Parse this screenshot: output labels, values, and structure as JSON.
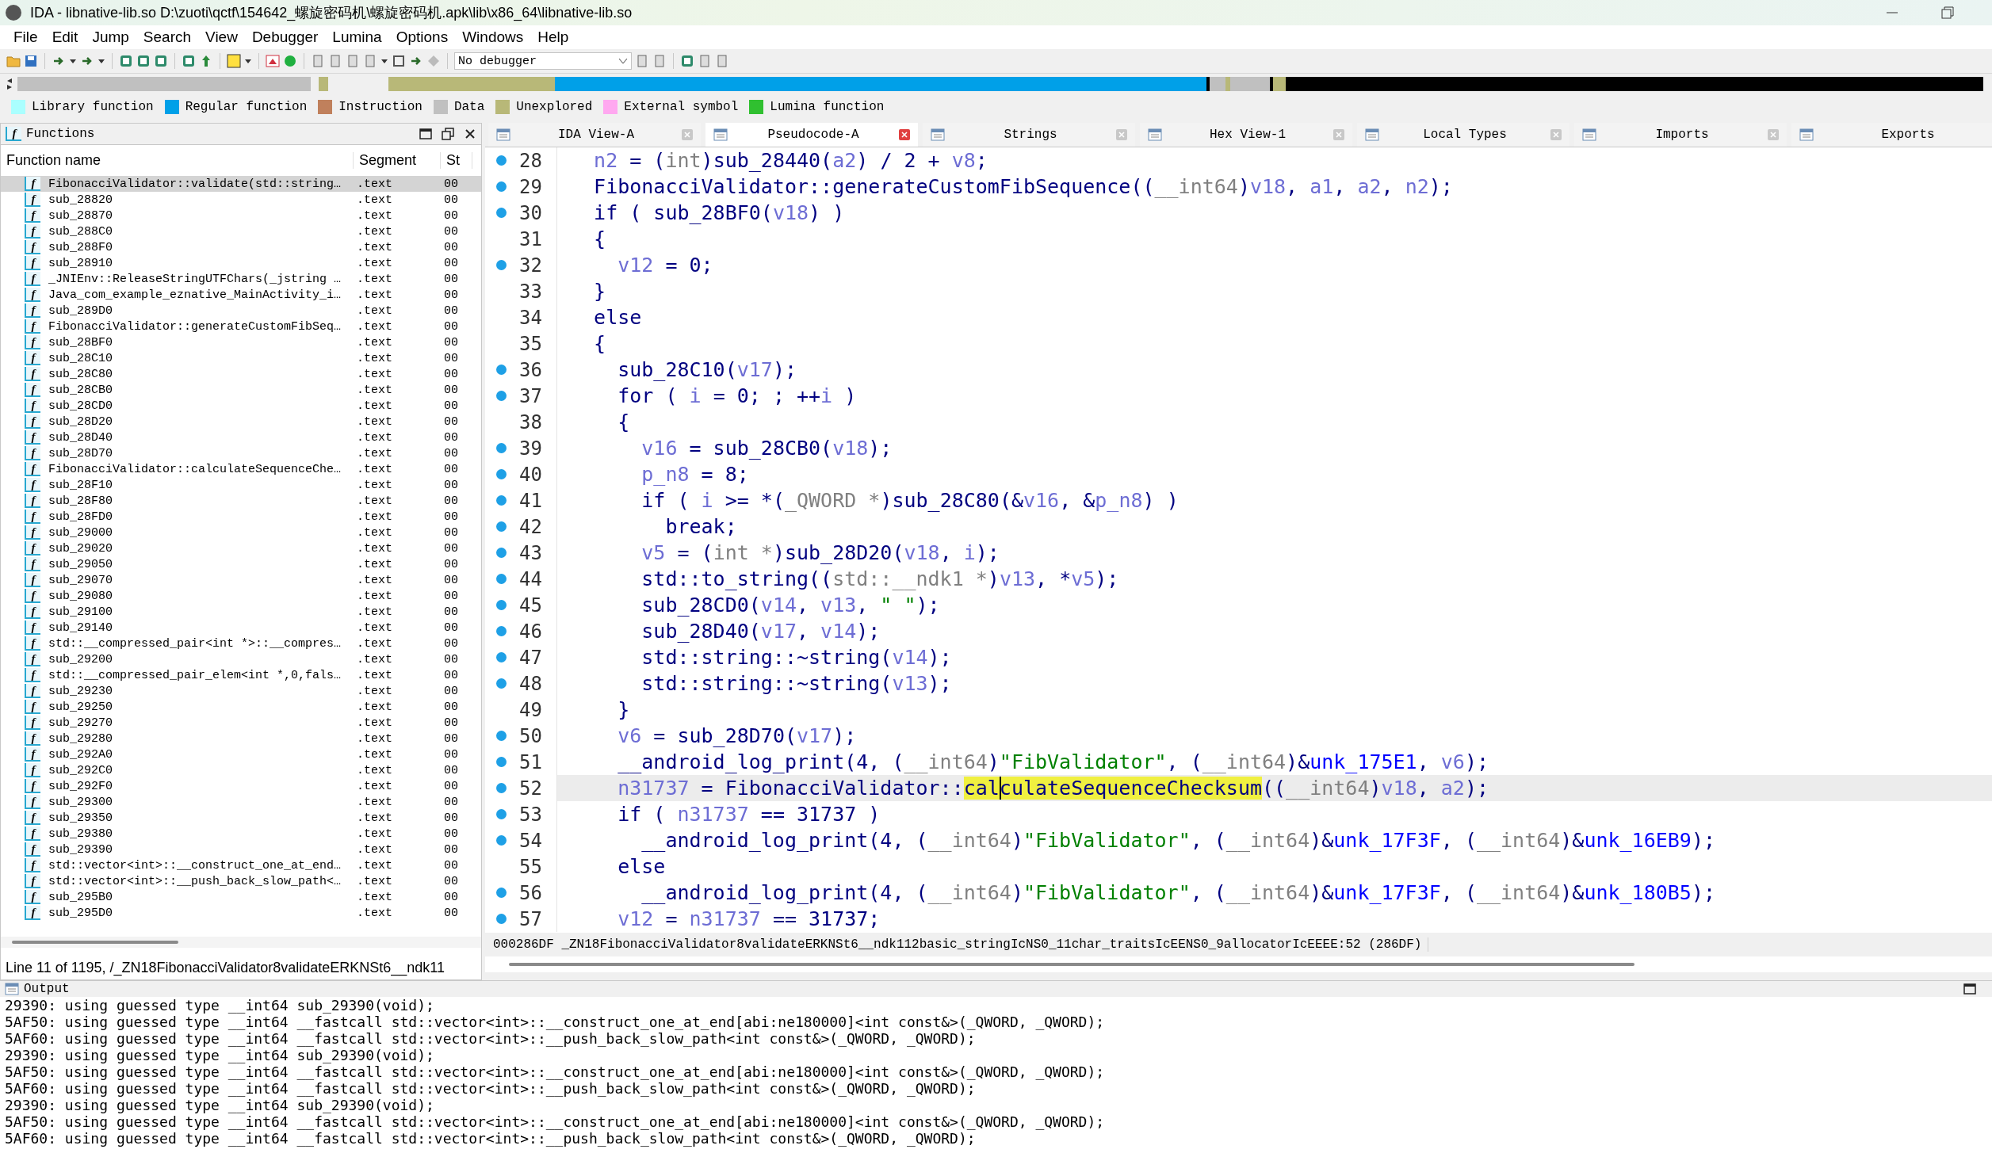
{
  "window": {
    "title": "IDA - libnative-lib.so D:\\zuoti\\qctf\\154642_螺旋密码机\\螺旋密码机.apk\\lib\\x86_64\\libnative-lib.so"
  },
  "menu": [
    "File",
    "Edit",
    "Jump",
    "Search",
    "View",
    "Debugger",
    "Lumina",
    "Options",
    "Windows",
    "Help"
  ],
  "toolbar": {
    "debugger_select": "No debugger"
  },
  "legend": [
    {
      "label": "Library function",
      "color": "#aaffff"
    },
    {
      "label": "Regular function",
      "color": "#00a0e8"
    },
    {
      "label": "Instruction",
      "color": "#c0805c"
    },
    {
      "label": "Data",
      "color": "#c0c0c0"
    },
    {
      "label": "Unexplored",
      "color": "#b8b878"
    },
    {
      "label": "External symbol",
      "color": "#ffa8f0"
    },
    {
      "label": "Lumina function",
      "color": "#30c030"
    }
  ],
  "functions": {
    "title": "Functions",
    "icon": "f",
    "columns": [
      "Function name",
      "Segment",
      "St"
    ],
    "rows": [
      {
        "icon": "f",
        "name": "FibonacciValidator::validate(std::string…",
        "segment": ".text",
        "st": "00",
        "selected": true
      },
      {
        "icon": "f",
        "name": "sub_28820",
        "segment": ".text",
        "st": "00",
        "selected": false
      },
      {
        "icon": "f",
        "name": "sub_28870",
        "segment": ".text",
        "st": "00",
        "selected": false
      },
      {
        "icon": "f",
        "name": "sub_288C0",
        "segment": ".text",
        "st": "00",
        "selected": false
      },
      {
        "icon": "f",
        "name": "sub_288F0",
        "segment": ".text",
        "st": "00",
        "selected": false
      },
      {
        "icon": "f",
        "name": "sub_28910",
        "segment": ".text",
        "st": "00",
        "selected": false
      },
      {
        "icon": "f",
        "name": "_JNIEnv::ReleaseStringUTFChars(_jstring …",
        "segment": ".text",
        "st": "00",
        "selected": false
      },
      {
        "icon": "f",
        "name": "Java_com_example_eznative_MainActivity_i…",
        "segment": ".text",
        "st": "00",
        "selected": false
      },
      {
        "icon": "f",
        "name": "sub_289D0",
        "segment": ".text",
        "st": "00",
        "selected": false
      },
      {
        "icon": "f",
        "name": "FibonacciValidator::generateCustomFibSeq…",
        "segment": ".text",
        "st": "00",
        "selected": false
      },
      {
        "icon": "f",
        "name": "sub_28BF0",
        "segment": ".text",
        "st": "00",
        "selected": false
      },
      {
        "icon": "f",
        "name": "sub_28C10",
        "segment": ".text",
        "st": "00",
        "selected": false
      },
      {
        "icon": "f",
        "name": "sub_28C80",
        "segment": ".text",
        "st": "00",
        "selected": false
      },
      {
        "icon": "f",
        "name": "sub_28CB0",
        "segment": ".text",
        "st": "00",
        "selected": false
      },
      {
        "icon": "f",
        "name": "sub_28CD0",
        "segment": ".text",
        "st": "00",
        "selected": false
      },
      {
        "icon": "f",
        "name": "sub_28D20",
        "segment": ".text",
        "st": "00",
        "selected": false
      },
      {
        "icon": "f",
        "name": "sub_28D40",
        "segment": ".text",
        "st": "00",
        "selected": false
      },
      {
        "icon": "f",
        "name": "sub_28D70",
        "segment": ".text",
        "st": "00",
        "selected": false
      },
      {
        "icon": "f",
        "name": "FibonacciValidator::calculateSequenceChe…",
        "segment": ".text",
        "st": "00",
        "selected": false
      },
      {
        "icon": "f",
        "name": "sub_28F10",
        "segment": ".text",
        "st": "00",
        "selected": false
      },
      {
        "icon": "f",
        "name": "sub_28F80",
        "segment": ".text",
        "st": "00",
        "selected": false
      },
      {
        "icon": "f",
        "name": "sub_28FD0",
        "segment": ".text",
        "st": "00",
        "selected": false
      },
      {
        "icon": "f",
        "name": "sub_29000",
        "segment": ".text",
        "st": "00",
        "selected": false
      },
      {
        "icon": "f",
        "name": "sub_29020",
        "segment": ".text",
        "st": "00",
        "selected": false
      },
      {
        "icon": "f",
        "name": "sub_29050",
        "segment": ".text",
        "st": "00",
        "selected": false
      },
      {
        "icon": "f",
        "name": "sub_29070",
        "segment": ".text",
        "st": "00",
        "selected": false
      },
      {
        "icon": "f",
        "name": "sub_29080",
        "segment": ".text",
        "st": "00",
        "selected": false
      },
      {
        "icon": "f",
        "name": "sub_29100",
        "segment": ".text",
        "st": "00",
        "selected": false
      },
      {
        "icon": "f",
        "name": "sub_29140",
        "segment": ".text",
        "st": "00",
        "selected": false
      },
      {
        "icon": "f",
        "name": "std::__compressed_pair<int *>::__compres…",
        "segment": ".text",
        "st": "00",
        "selected": false
      },
      {
        "icon": "f",
        "name": "sub_29200",
        "segment": ".text",
        "st": "00",
        "selected": false
      },
      {
        "icon": "f",
        "name": "std::__compressed_pair_elem<int *,0,fals…",
        "segment": ".text",
        "st": "00",
        "selected": false
      },
      {
        "icon": "f",
        "name": "sub_29230",
        "segment": ".text",
        "st": "00",
        "selected": false
      },
      {
        "icon": "f",
        "name": "sub_29250",
        "segment": ".text",
        "st": "00",
        "selected": false
      },
      {
        "icon": "f",
        "name": "sub_29270",
        "segment": ".text",
        "st": "00",
        "selected": false
      },
      {
        "icon": "f",
        "name": "sub_29280",
        "segment": ".text",
        "st": "00",
        "selected": false
      },
      {
        "icon": "f",
        "name": "sub_292A0",
        "segment": ".text",
        "st": "00",
        "selected": false
      },
      {
        "icon": "f",
        "name": "sub_292C0",
        "segment": ".text",
        "st": "00",
        "selected": false
      },
      {
        "icon": "f",
        "name": "sub_292F0",
        "segment": ".text",
        "st": "00",
        "selected": false
      },
      {
        "icon": "f",
        "name": "sub_29300",
        "segment": ".text",
        "st": "00",
        "selected": false
      },
      {
        "icon": "f",
        "name": "sub_29350",
        "segment": ".text",
        "st": "00",
        "selected": false
      },
      {
        "icon": "f",
        "name": "sub_29380",
        "segment": ".text",
        "st": "00",
        "selected": false
      },
      {
        "icon": "f",
        "name": "sub_29390",
        "segment": ".text",
        "st": "00",
        "selected": false
      },
      {
        "icon": "f",
        "name": "std::vector<int>::__construct_one_at_end…",
        "segment": ".text",
        "st": "00",
        "selected": false
      },
      {
        "icon": "f",
        "name": "std::vector<int>::__push_back_slow_path<…",
        "segment": ".text",
        "st": "00",
        "selected": false
      },
      {
        "icon": "f",
        "name": "sub_295B0",
        "segment": ".text",
        "st": "00",
        "selected": false
      },
      {
        "icon": "f",
        "name": "sub_295D0",
        "segment": ".text",
        "st": "00",
        "selected": false
      }
    ],
    "status": "Line 11 of 1195, /_ZN18FibonacciValidator8validateERKNSt6__ndk11"
  },
  "tabs": [
    {
      "label": "IDA View-A",
      "selected": false,
      "closable": true
    },
    {
      "label": "Pseudocode-A",
      "selected": true,
      "closable": true
    },
    {
      "label": "Strings",
      "selected": false,
      "closable": true
    },
    {
      "label": "Hex View-1",
      "selected": false,
      "closable": true
    },
    {
      "label": "Local Types",
      "selected": false,
      "closable": true
    },
    {
      "label": "Imports",
      "selected": false,
      "closable": true
    },
    {
      "label": "Exports",
      "selected": false,
      "closable": false
    }
  ],
  "code": {
    "lines": [
      {
        "number": "28",
        "dot": true,
        "selected": false,
        "tokens": [
          {
            "kind": "var",
            "text": "  n2"
          },
          {
            "kind": "plain",
            "text": " = ("
          },
          {
            "kind": "type",
            "text": "int"
          },
          {
            "kind": "plain",
            "text": ")sub_28440("
          },
          {
            "kind": "var",
            "text": "a2"
          },
          {
            "kind": "plain",
            "text": ") / 2 + "
          },
          {
            "kind": "var",
            "text": "v8"
          },
          {
            "kind": "plain",
            "text": ";"
          }
        ]
      },
      {
        "number": "29",
        "dot": true,
        "selected": false,
        "tokens": [
          {
            "kind": "plain",
            "text": "  FibonacciValidator::generateCustomFibSequence(("
          },
          {
            "kind": "type",
            "text": "__int64"
          },
          {
            "kind": "plain",
            "text": ")"
          },
          {
            "kind": "var",
            "text": "v18"
          },
          {
            "kind": "plain",
            "text": ", "
          },
          {
            "kind": "var",
            "text": "a1"
          },
          {
            "kind": "plain",
            "text": ", "
          },
          {
            "kind": "var",
            "text": "a2"
          },
          {
            "kind": "plain",
            "text": ", "
          },
          {
            "kind": "var",
            "text": "n2"
          },
          {
            "kind": "plain",
            "text": ");"
          }
        ]
      },
      {
        "number": "30",
        "dot": true,
        "selected": false,
        "tokens": [
          {
            "kind": "plain",
            "text": "  if ( sub_28BF0("
          },
          {
            "kind": "var",
            "text": "v18"
          },
          {
            "kind": "plain",
            "text": ") )"
          }
        ]
      },
      {
        "number": "31",
        "dot": false,
        "selected": false,
        "tokens": [
          {
            "kind": "plain",
            "text": "  {"
          }
        ]
      },
      {
        "number": "32",
        "dot": true,
        "selected": false,
        "tokens": [
          {
            "kind": "var",
            "text": "    v12"
          },
          {
            "kind": "plain",
            "text": " = 0;"
          }
        ]
      },
      {
        "number": "33",
        "dot": false,
        "selected": false,
        "tokens": [
          {
            "kind": "plain",
            "text": "  }"
          }
        ]
      },
      {
        "number": "34",
        "dot": false,
        "selected": false,
        "tokens": [
          {
            "kind": "plain",
            "text": "  else"
          }
        ]
      },
      {
        "number": "35",
        "dot": false,
        "selected": false,
        "tokens": [
          {
            "kind": "plain",
            "text": "  {"
          }
        ]
      },
      {
        "number": "36",
        "dot": true,
        "selected": false,
        "tokens": [
          {
            "kind": "plain",
            "text": "    sub_28C10("
          },
          {
            "kind": "var",
            "text": "v17"
          },
          {
            "kind": "plain",
            "text": ");"
          }
        ]
      },
      {
        "number": "37",
        "dot": true,
        "selected": false,
        "tokens": [
          {
            "kind": "plain",
            "text": "    for ( "
          },
          {
            "kind": "var",
            "text": "i"
          },
          {
            "kind": "plain",
            "text": " = 0; ; ++"
          },
          {
            "kind": "var",
            "text": "i"
          },
          {
            "kind": "plain",
            "text": " )"
          }
        ]
      },
      {
        "number": "38",
        "dot": false,
        "selected": false,
        "tokens": [
          {
            "kind": "plain",
            "text": "    {"
          }
        ]
      },
      {
        "number": "39",
        "dot": true,
        "selected": false,
        "tokens": [
          {
            "kind": "var",
            "text": "      v16"
          },
          {
            "kind": "plain",
            "text": " = sub_28CB0("
          },
          {
            "kind": "var",
            "text": "v18"
          },
          {
            "kind": "plain",
            "text": ");"
          }
        ]
      },
      {
        "number": "40",
        "dot": true,
        "selected": false,
        "tokens": [
          {
            "kind": "var",
            "text": "      p_n8"
          },
          {
            "kind": "plain",
            "text": " = 8;"
          }
        ]
      },
      {
        "number": "41",
        "dot": true,
        "selected": false,
        "tokens": [
          {
            "kind": "plain",
            "text": "      if ( "
          },
          {
            "kind": "var",
            "text": "i"
          },
          {
            "kind": "plain",
            "text": " >= *("
          },
          {
            "kind": "type",
            "text": "_QWORD *"
          },
          {
            "kind": "plain",
            "text": ")sub_28C80(&"
          },
          {
            "kind": "var",
            "text": "v16"
          },
          {
            "kind": "plain",
            "text": ", &"
          },
          {
            "kind": "var",
            "text": "p_n8"
          },
          {
            "kind": "plain",
            "text": ") )"
          }
        ]
      },
      {
        "number": "42",
        "dot": true,
        "selected": false,
        "tokens": [
          {
            "kind": "plain",
            "text": "        break;"
          }
        ]
      },
      {
        "number": "43",
        "dot": true,
        "selected": false,
        "tokens": [
          {
            "kind": "var",
            "text": "      v5"
          },
          {
            "kind": "plain",
            "text": " = ("
          },
          {
            "kind": "type",
            "text": "int *"
          },
          {
            "kind": "plain",
            "text": ")sub_28D20("
          },
          {
            "kind": "var",
            "text": "v18"
          },
          {
            "kind": "plain",
            "text": ", "
          },
          {
            "kind": "var",
            "text": "i"
          },
          {
            "kind": "plain",
            "text": ");"
          }
        ]
      },
      {
        "number": "44",
        "dot": true,
        "selected": false,
        "tokens": [
          {
            "kind": "plain",
            "text": "      std::to_string(("
          },
          {
            "kind": "type",
            "text": "std::__ndk1 *"
          },
          {
            "kind": "plain",
            "text": ")"
          },
          {
            "kind": "var",
            "text": "v13"
          },
          {
            "kind": "plain",
            "text": ", *"
          },
          {
            "kind": "var",
            "text": "v5"
          },
          {
            "kind": "plain",
            "text": ");"
          }
        ]
      },
      {
        "number": "45",
        "dot": true,
        "selected": false,
        "tokens": [
          {
            "kind": "plain",
            "text": "      sub_28CD0("
          },
          {
            "kind": "var",
            "text": "v14"
          },
          {
            "kind": "plain",
            "text": ", "
          },
          {
            "kind": "var",
            "text": "v13"
          },
          {
            "kind": "plain",
            "text": ", "
          },
          {
            "kind": "str",
            "text": "\" \""
          },
          {
            "kind": "plain",
            "text": ");"
          }
        ]
      },
      {
        "number": "46",
        "dot": true,
        "selected": false,
        "tokens": [
          {
            "kind": "plain",
            "text": "      sub_28D40("
          },
          {
            "kind": "var",
            "text": "v17"
          },
          {
            "kind": "plain",
            "text": ", "
          },
          {
            "kind": "var",
            "text": "v14"
          },
          {
            "kind": "plain",
            "text": ");"
          }
        ]
      },
      {
        "number": "47",
        "dot": true,
        "selected": false,
        "tokens": [
          {
            "kind": "plain",
            "text": "      std::string::~string("
          },
          {
            "kind": "var",
            "text": "v14"
          },
          {
            "kind": "plain",
            "text": ");"
          }
        ]
      },
      {
        "number": "48",
        "dot": true,
        "selected": false,
        "tokens": [
          {
            "kind": "plain",
            "text": "      std::string::~string("
          },
          {
            "kind": "var",
            "text": "v13"
          },
          {
            "kind": "plain",
            "text": ");"
          }
        ]
      },
      {
        "number": "49",
        "dot": false,
        "selected": false,
        "tokens": [
          {
            "kind": "plain",
            "text": "    }"
          }
        ]
      },
      {
        "number": "50",
        "dot": true,
        "selected": false,
        "tokens": [
          {
            "kind": "var",
            "text": "    v6"
          },
          {
            "kind": "plain",
            "text": " = sub_28D70("
          },
          {
            "kind": "var",
            "text": "v17"
          },
          {
            "kind": "plain",
            "text": ");"
          }
        ]
      },
      {
        "number": "51",
        "dot": true,
        "selected": false,
        "tokens": [
          {
            "kind": "plain",
            "text": "    __android_log_print(4, ("
          },
          {
            "kind": "type",
            "text": "__int64"
          },
          {
            "kind": "plain",
            "text": ")"
          },
          {
            "kind": "str",
            "text": "\"FibValidator\""
          },
          {
            "kind": "plain",
            "text": ", ("
          },
          {
            "kind": "type",
            "text": "__int64"
          },
          {
            "kind": "plain",
            "text": ")&"
          },
          {
            "kind": "addr",
            "text": "unk_175E1"
          },
          {
            "kind": "plain",
            "text": ", "
          },
          {
            "kind": "var",
            "text": "v6"
          },
          {
            "kind": "plain",
            "text": ");"
          }
        ]
      },
      {
        "number": "52",
        "dot": true,
        "selected": true,
        "tokens": [
          {
            "kind": "var",
            "text": "    n31737"
          },
          {
            "kind": "plain",
            "text": " = FibonacciValidator::"
          },
          {
            "kind": "highlight",
            "text": "cal"
          },
          {
            "kind": "highlight_caret",
            "text": "culateSequenceChecksum"
          },
          {
            "kind": "plain",
            "text": "(("
          },
          {
            "kind": "type",
            "text": "__int64"
          },
          {
            "kind": "plain",
            "text": ")"
          },
          {
            "kind": "var",
            "text": "v18"
          },
          {
            "kind": "plain",
            "text": ", "
          },
          {
            "kind": "var",
            "text": "a2"
          },
          {
            "kind": "plain",
            "text": ");"
          }
        ]
      },
      {
        "number": "53",
        "dot": true,
        "selected": false,
        "tokens": [
          {
            "kind": "plain",
            "text": "    if ( "
          },
          {
            "kind": "var",
            "text": "n31737"
          },
          {
            "kind": "plain",
            "text": " == 31737 )"
          }
        ]
      },
      {
        "number": "54",
        "dot": true,
        "selected": false,
        "tokens": [
          {
            "kind": "plain",
            "text": "      __android_log_print(4, ("
          },
          {
            "kind": "type",
            "text": "__int64"
          },
          {
            "kind": "plain",
            "text": ")"
          },
          {
            "kind": "str",
            "text": "\"FibValidator\""
          },
          {
            "kind": "plain",
            "text": ", ("
          },
          {
            "kind": "type",
            "text": "__int64"
          },
          {
            "kind": "plain",
            "text": ")&"
          },
          {
            "kind": "addr",
            "text": "unk_17F3F"
          },
          {
            "kind": "plain",
            "text": ", ("
          },
          {
            "kind": "type",
            "text": "__int64"
          },
          {
            "kind": "plain",
            "text": ")&"
          },
          {
            "kind": "addr",
            "text": "unk_16EB9"
          },
          {
            "kind": "plain",
            "text": ");"
          }
        ]
      },
      {
        "number": "55",
        "dot": false,
        "selected": false,
        "tokens": [
          {
            "kind": "plain",
            "text": "    else"
          }
        ]
      },
      {
        "number": "56",
        "dot": true,
        "selected": false,
        "tokens": [
          {
            "kind": "plain",
            "text": "      __android_log_print(4, ("
          },
          {
            "kind": "type",
            "text": "__int64"
          },
          {
            "kind": "plain",
            "text": ")"
          },
          {
            "kind": "str",
            "text": "\"FibValidator\""
          },
          {
            "kind": "plain",
            "text": ", ("
          },
          {
            "kind": "type",
            "text": "__int64"
          },
          {
            "kind": "plain",
            "text": ")&"
          },
          {
            "kind": "addr",
            "text": "unk_17F3F"
          },
          {
            "kind": "plain",
            "text": ", ("
          },
          {
            "kind": "type",
            "text": "__int64"
          },
          {
            "kind": "plain",
            "text": ")&"
          },
          {
            "kind": "addr",
            "text": "unk_180B5"
          },
          {
            "kind": "plain",
            "text": ");"
          }
        ]
      },
      {
        "number": "57",
        "dot": true,
        "selected": false,
        "tokens": [
          {
            "kind": "var",
            "text": "    v12"
          },
          {
            "kind": "plain",
            "text": " = "
          },
          {
            "kind": "var",
            "text": "n31737"
          },
          {
            "kind": "plain",
            "text": " == 31737;"
          }
        ]
      }
    ],
    "status": "000286DF _ZN18FibonacciValidator8validateERKNSt6__ndk112basic_stringIcNS0_11char_traitsIcEENS0_9allocatorIcEEEE:52 (286DF)"
  },
  "output": {
    "title": "Output",
    "lines": [
      "29390: using guessed type __int64 sub_29390(void);",
      "5AF50: using guessed type __int64 __fastcall std::vector<int>::__construct_one_at_end[abi:ne180000]<int const&>(_QWORD, _QWORD);",
      "5AF60: using guessed type __int64 __fastcall std::vector<int>::__push_back_slow_path<int const&>(_QWORD, _QWORD);",
      "29390: using guessed type __int64 sub_29390(void);",
      "5AF50: using guessed type __int64 __fastcall std::vector<int>::__construct_one_at_end[abi:ne180000]<int const&>(_QWORD, _QWORD);",
      "5AF60: using guessed type __int64 __fastcall std::vector<int>::__push_back_slow_path<int const&>(_QWORD, _QWORD);",
      "29390: using guessed type __int64 sub_29390(void);",
      "5AF50: using guessed type __int64 __fastcall std::vector<int>::__construct_one_at_end[abi:ne180000]<int const&>(_QWORD, _QWORD);",
      "5AF60: using guessed type __int64 __fastcall std::vector<int>::__push_back_slow_path<int const&>(_QWORD, _QWORD);"
    ]
  }
}
